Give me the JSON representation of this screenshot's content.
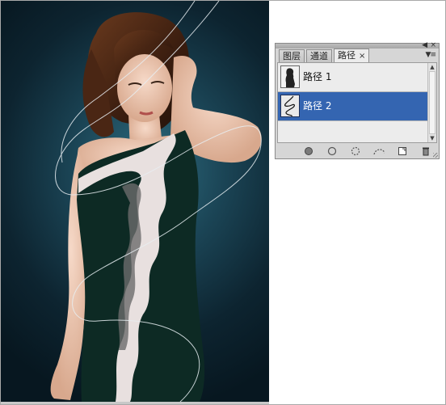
{
  "panel": {
    "tabs": [
      {
        "label": "图层"
      },
      {
        "label": "通道"
      },
      {
        "label": "路径",
        "close": "×"
      }
    ],
    "collapse_icon": "double-chevron-left-icon",
    "close_icon": "close-icon",
    "menu_icon": "panel-menu-icon",
    "paths": [
      {
        "name": "路径 1",
        "selected": false
      },
      {
        "name": "路径 2",
        "selected": true
      }
    ],
    "toolbar": [
      "fill-path-icon",
      "stroke-path-icon",
      "load-as-selection-icon",
      "make-work-path-icon",
      "new-path-icon",
      "delete-path-icon"
    ]
  },
  "colors": {
    "selection": "#3465b1",
    "background_teal": "#1b4556",
    "dress": "#0d2a24",
    "ruffle": "#e8e0df"
  }
}
